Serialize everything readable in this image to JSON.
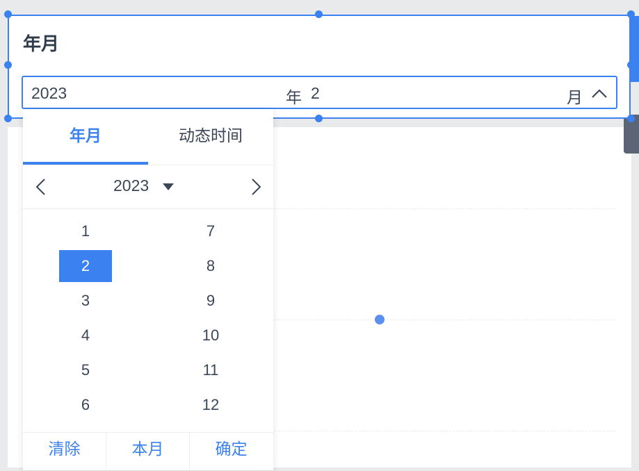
{
  "widget": {
    "title": "年月",
    "input": {
      "year": "2023",
      "year_suffix": "年",
      "month": "2",
      "month_suffix": "月"
    }
  },
  "picker": {
    "tabs": [
      {
        "label": "年月",
        "active": true
      },
      {
        "label": "动态时间",
        "active": false
      }
    ],
    "year": "2023",
    "months": [
      "1",
      "2",
      "3",
      "4",
      "5",
      "6",
      "7",
      "8",
      "9",
      "10",
      "11",
      "12"
    ],
    "selected_month": "2",
    "footer": {
      "clear_label": "清除",
      "this_month_label": "本月",
      "confirm_label": "确定"
    }
  },
  "colors": {
    "accent": "#3b82f0",
    "text": "#3b4658"
  },
  "icons": {
    "input_toggle": "chevron-up-icon",
    "prev_year": "chevron-left-icon",
    "next_year": "chevron-right-icon",
    "year_dropdown": "caret-down-icon"
  }
}
